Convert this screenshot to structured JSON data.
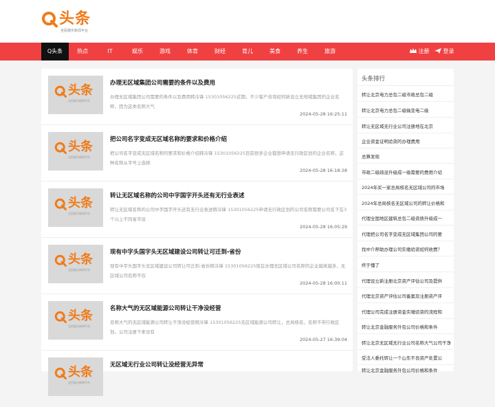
{
  "brand": {
    "name": "头条",
    "tagline": "全民娱乐新闻平台"
  },
  "nav": {
    "items": [
      "Q头条",
      "热点",
      "IT",
      "娱乐",
      "游戏",
      "体育",
      "财经",
      "育儿",
      "美食",
      "养生",
      "旅游"
    ],
    "active_index": 0,
    "register": "注册",
    "login": "登录"
  },
  "articles": [
    {
      "title": "办理无区域集团公司需要的条件以及费用",
      "desc": "办理无区域集团公司需要的条件以及费用韩泠锋 15301056225近期，不少客户咨询如何新设立无地域集团的企业名称，因为这类名称大气",
      "date": "2024-05-28 16:25:11"
    },
    {
      "title": "把公司名字变成无区域名称的要求和价格介绍",
      "desc": "把公司名字变成无区域名称的要求和价格介绍韩泠锋 15301056225目前很多企业都想申请无行政区划的企业名称，这种名称从字号上选择",
      "date": "2024-05-28 16:18:28"
    },
    {
      "title": "转让无区域名称的公司中字国字开头还有无行业表述",
      "desc": "转让无区域名称的公司中字国字开头还有无行业表述韩泠锋 15301056225申请无行政区划的公司名称需要公司名下在3个以上不同省市设",
      "date": "2024-05-28 16:05:29"
    },
    {
      "title": "现有中字头国字头无区域建设公司转让可迁到-省份",
      "desc": "现有中字头国字头无区域建设公司转让可迁到-省份韩泠锋 15301056225现在办理无区域公司名称的企业越来越多，无区域公司名称不仅",
      "date": "2024-05-28 16:00:11"
    },
    {
      "title": "名称大气的无区域能源公司转让干净没经营",
      "desc": "名称大气的无区域能源公司转让干净没经营韩泠锋 15301056225无区域能源公司转让，总局核名，名称不带行政区划，公司注册下来没有",
      "date": "2024-05-27 16:39:04"
    },
    {
      "title": "无区域无行业公司转让没经营无异常",
      "desc": "",
      "date": ""
    }
  ],
  "sidebar": {
    "heading": "头条排行",
    "items": [
      "转让北京电力总包二级市政总包二级",
      "转让北京电力总包二级输变电二级",
      "转让无区域无行业公司注册地在北京",
      "企业资金证明验资的办理费用",
      "总算发现",
      "市政二级疏浚升级成一级需要的费用介绍",
      "2024年买一家总局核名无区域公司的市场",
      "2024年总局核名无区域公司的转让价格和",
      "代理全国地区建筑总包二级资质升级成一",
      "代理把公司名字变成无区域集团公司的要",
      "找中介帮助办理公司实缴验资如何收费？",
      "终于懂了",
      "代理设立新注册北京资产评估公司及提供",
      "代理北京资产评估公司备案及注册资产评",
      "代理公司完成注册资金实缴验资的流程和",
      "转让北京金融服务外包公司价格和条件",
      "转让北京无区域无行业公司名称大气公司干净",
      "受法人委托转让一个山东不良资产处置公",
      "转让北京金融服务外包公司价格和条件"
    ]
  },
  "colors": {
    "nav_bg": "#f04142",
    "brand": "#f07b1a",
    "active_nav": "#111111"
  }
}
